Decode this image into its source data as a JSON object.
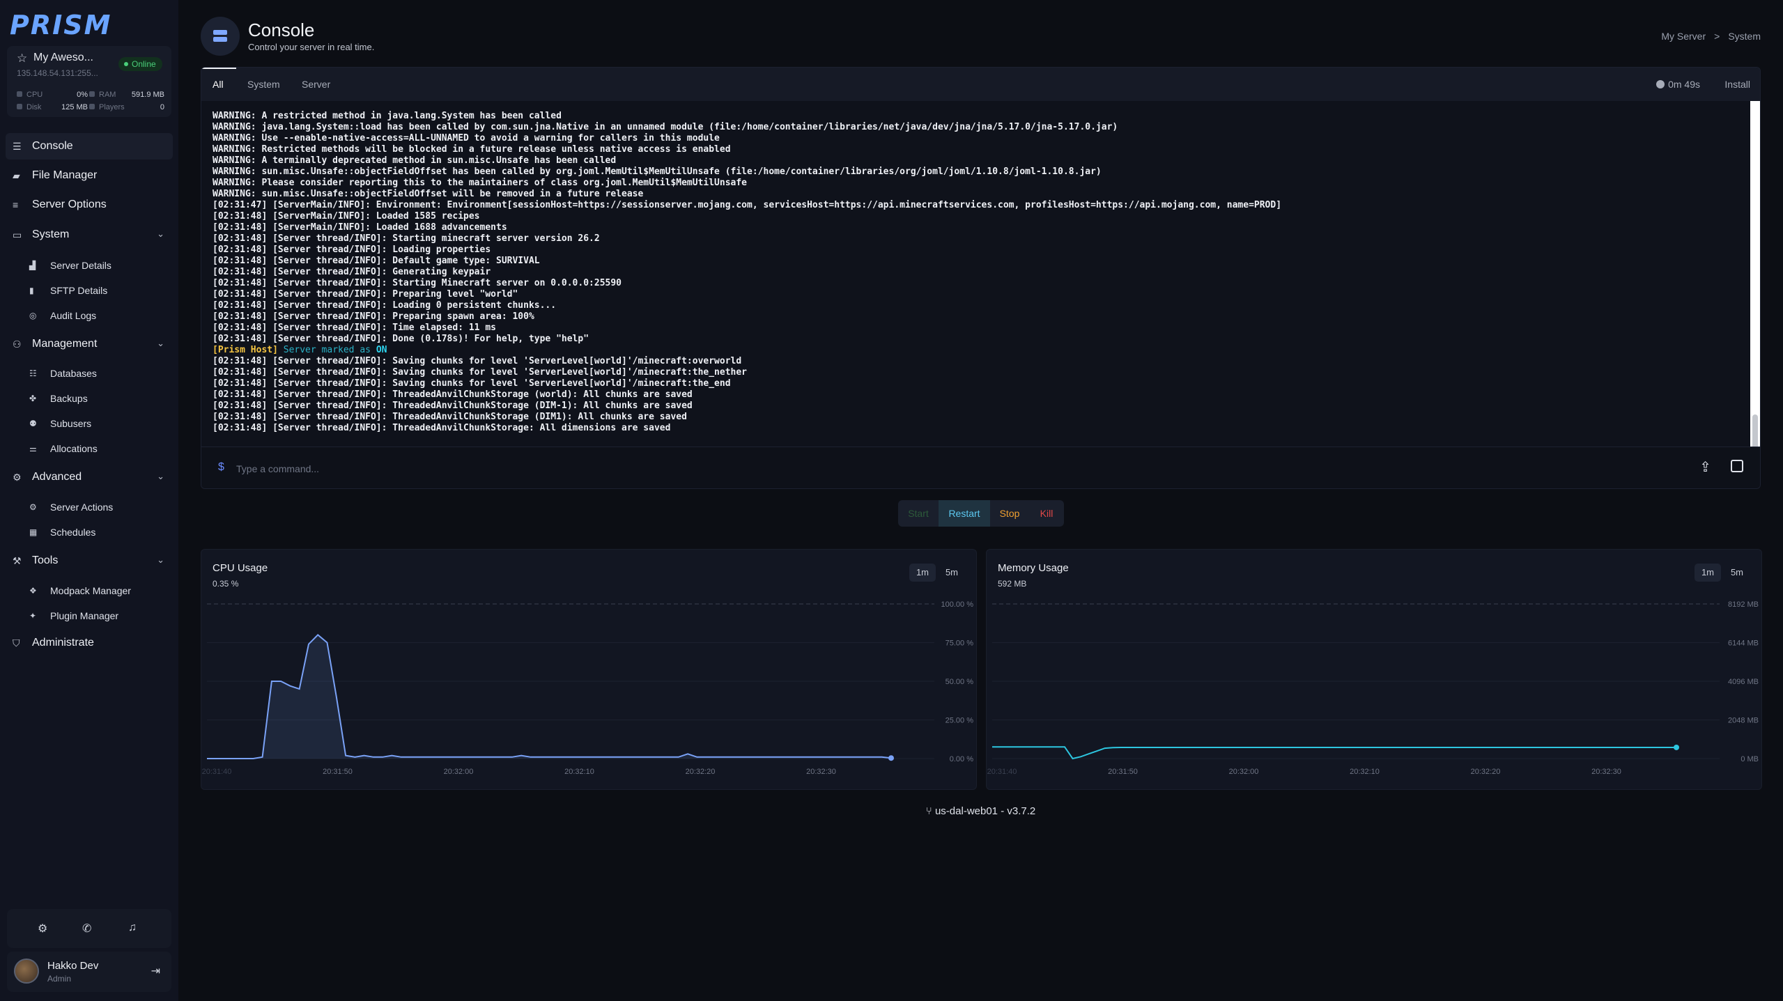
{
  "brand": "PRISM",
  "server": {
    "name": "My Aweso...",
    "address": "135.148.54.131:255...",
    "status": "Online",
    "stats": [
      {
        "label": "CPU",
        "value": "0%"
      },
      {
        "label": "RAM",
        "value": "591.9 MB"
      },
      {
        "label": "Disk",
        "value": "125 MB"
      },
      {
        "label": "Players",
        "value": "0"
      }
    ]
  },
  "nav": {
    "console": "Console",
    "file_manager": "File Manager",
    "server_options": "Server Options",
    "system": {
      "label": "System",
      "items": [
        "Server Details",
        "SFTP Details",
        "Audit Logs"
      ]
    },
    "management": {
      "label": "Management",
      "items": [
        "Databases",
        "Backups",
        "Subusers",
        "Allocations"
      ]
    },
    "advanced": {
      "label": "Advanced",
      "items": [
        "Server Actions",
        "Schedules"
      ]
    },
    "tools": {
      "label": "Tools",
      "items": [
        "Modpack Manager",
        "Plugin Manager"
      ]
    },
    "administrate": "Administrate"
  },
  "user": {
    "name": "Hakko Dev",
    "role": "Admin"
  },
  "header": {
    "title": "Console",
    "subtitle": "Control your server in real time.",
    "breadcrumb": [
      "My Server",
      "System"
    ]
  },
  "console": {
    "tabs": [
      "All",
      "System",
      "Server"
    ],
    "uptime": "0m 49s",
    "install_label": "Install",
    "log_lines": [
      "WARNING: A restricted method in java.lang.System has been called",
      "WARNING: java.lang.System::load has been called by com.sun.jna.Native in an unnamed module (file:/home/container/libraries/net/java/dev/jna/jna/5.17.0/jna-5.17.0.jar)",
      "WARNING: Use --enable-native-access=ALL-UNNAMED to avoid a warning for callers in this module",
      "WARNING: Restricted methods will be blocked in a future release unless native access is enabled",
      "WARNING: A terminally deprecated method in sun.misc.Unsafe has been called",
      "WARNING: sun.misc.Unsafe::objectFieldOffset has been called by org.joml.MemUtil$MemUtilUnsafe (file:/home/container/libraries/org/joml/joml/1.10.8/joml-1.10.8.jar)",
      "WARNING: Please consider reporting this to the maintainers of class org.joml.MemUtil$MemUtilUnsafe",
      "WARNING: sun.misc.Unsafe::objectFieldOffset will be removed in a future release",
      "[02:31:47] [ServerMain/INFO]: Environment: Environment[sessionHost=https://sessionserver.mojang.com, servicesHost=https://api.minecraftservices.com, profilesHost=https://api.mojang.com, name=PROD]",
      "[02:31:48] [ServerMain/INFO]: Loaded 1585 recipes",
      "[02:31:48] [ServerMain/INFO]: Loaded 1688 advancements",
      "[02:31:48] [Server thread/INFO]: Starting minecraft server version 26.2",
      "[02:31:48] [Server thread/INFO]: Loading properties",
      "[02:31:48] [Server thread/INFO]: Default game type: SURVIVAL",
      "[02:31:48] [Server thread/INFO]: Generating keypair",
      "[02:31:48] [Server thread/INFO]: Starting Minecraft server on 0.0.0.0:25590",
      "[02:31:48] [Server thread/INFO]: Preparing level \"world\"",
      "[02:31:48] [Server thread/INFO]: Loading 0 persistent chunks...",
      "[02:31:48] [Server thread/INFO]: Preparing spawn area: 100%",
      "[02:31:48] [Server thread/INFO]: Time elapsed: 11 ms",
      "[02:31:48] [Server thread/INFO]: Done (0.178s)! For help, type \"help\""
    ],
    "prism_line": {
      "tag": "[Prism Host]",
      "text": "Server marked as",
      "state": "ON"
    },
    "log_lines_after": [
      "[02:31:48] [Server thread/INFO]: Saving chunks for level 'ServerLevel[world]'/minecraft:overworld",
      "[02:31:48] [Server thread/INFO]: Saving chunks for level 'ServerLevel[world]'/minecraft:the_nether",
      "[02:31:48] [Server thread/INFO]: Saving chunks for level 'ServerLevel[world]'/minecraft:the_end",
      "[02:31:48] [Server thread/INFO]: ThreadedAnvilChunkStorage (world): All chunks are saved",
      "[02:31:48] [Server thread/INFO]: ThreadedAnvilChunkStorage (DIM-1): All chunks are saved",
      "[02:31:48] [Server thread/INFO]: ThreadedAnvilChunkStorage (DIM1): All chunks are saved",
      "[02:31:48] [Server thread/INFO]: ThreadedAnvilChunkStorage: All dimensions are saved"
    ],
    "command_placeholder": "Type a command...",
    "prompt": "$"
  },
  "power": {
    "start": "Start",
    "restart": "Restart",
    "stop": "Stop",
    "kill": "Kill"
  },
  "charts": {
    "ranges": [
      "1m",
      "5m"
    ],
    "cpu": {
      "title": "CPU Usage",
      "value": "0.35 %"
    },
    "memory": {
      "title": "Memory Usage",
      "value": "592 MB"
    }
  },
  "chart_data": [
    {
      "type": "area",
      "title": "CPU Usage",
      "x": [
        "20:31:40",
        "20:31:50",
        "20:32:00",
        "20:32:10",
        "20:32:20",
        "20:32:30"
      ],
      "y_ticks": [
        "100.00 %",
        "75.00 %",
        "50.00 %",
        "25.00 %",
        "0.00 %"
      ],
      "ylim": [
        0,
        100
      ],
      "color": "#7aa2f7",
      "values": [
        0,
        0,
        0,
        0,
        0,
        0,
        1,
        50,
        50,
        47,
        45,
        74,
        80,
        75,
        40,
        2,
        1,
        2,
        1,
        1,
        2,
        1,
        1,
        1,
        1,
        1,
        1,
        1,
        1,
        1,
        1,
        1,
        1,
        1,
        2,
        1,
        1,
        1,
        1,
        1,
        1,
        1,
        1,
        1,
        1,
        1,
        1,
        1,
        1,
        1,
        1,
        1,
        3,
        1,
        1,
        1,
        1,
        1,
        1,
        1,
        1,
        1,
        1,
        1,
        1,
        1,
        1,
        1,
        1,
        1,
        1,
        1,
        1,
        1,
        0.35
      ]
    },
    {
      "type": "line",
      "title": "Memory Usage",
      "x": [
        "20:31:40",
        "20:31:50",
        "20:32:00",
        "20:32:10",
        "20:32:20",
        "20:32:30"
      ],
      "y_ticks": [
        "8192 MB",
        "6144 MB",
        "4096 MB",
        "2048 MB",
        "0 MB"
      ],
      "ylim": [
        0,
        8192
      ],
      "color": "#2dc6e0",
      "values": [
        620,
        620,
        620,
        620,
        620,
        620,
        620,
        620,
        620,
        620,
        0,
        100,
        250,
        400,
        550,
        580,
        592,
        592,
        592,
        592,
        592,
        592,
        592,
        592,
        592,
        592,
        592,
        592,
        592,
        592,
        592,
        592,
        592,
        592,
        592,
        592,
        592,
        592,
        592,
        592,
        592,
        592,
        592,
        592,
        592,
        592,
        592,
        592,
        592,
        592,
        592,
        592,
        592,
        592,
        592,
        592,
        592,
        592,
        592,
        592,
        592,
        592,
        592,
        592,
        592,
        592,
        592,
        592,
        592,
        592,
        592,
        592,
        592,
        592,
        592,
        592,
        592,
        592,
        592,
        592,
        592,
        592,
        592,
        592,
        592,
        592
      ]
    }
  ],
  "footer": "us-dal-web01 - v3.7.2"
}
